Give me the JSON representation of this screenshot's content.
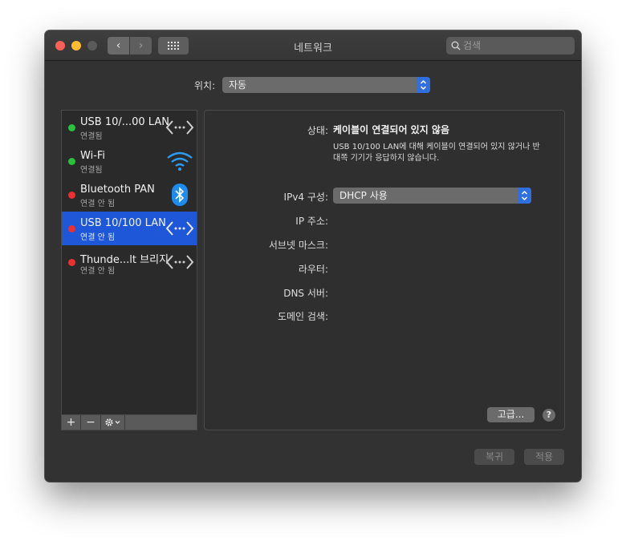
{
  "window": {
    "title": "네트워크"
  },
  "toolbar": {
    "back_icon": "chevron-left-icon",
    "forward_icon": "chevron-right-icon",
    "grid_icon": "grid-icon",
    "search_placeholder": "검색"
  },
  "location": {
    "label": "위치:",
    "value": "자동"
  },
  "services": [
    {
      "name": "USB 10/...00 LAN",
      "status": "연결됨",
      "dot_color": "#27c33c",
      "icon": "ethernet-icon",
      "selected": false
    },
    {
      "name": "Wi-Fi",
      "status": "연결됨",
      "dot_color": "#27c33c",
      "icon": "wifi-icon",
      "selected": false
    },
    {
      "name": "Bluetooth PAN",
      "status": "연결 안 됨",
      "dot_color": "#ed2f2f",
      "icon": "bluetooth-icon",
      "selected": false
    },
    {
      "name": "USB 10/100 LAN",
      "status": "연결 안 됨",
      "dot_color": "#ed2f2f",
      "icon": "ethernet-icon",
      "selected": true
    },
    {
      "name": "Thunde...lt 브리지",
      "status": "연결 안 됨",
      "dot_color": "#ed2f2f",
      "icon": "ethernet-icon",
      "selected": false
    }
  ],
  "sidebar_toolbar": {
    "add": "+",
    "remove": "−",
    "gear_icon": "gear-icon"
  },
  "detail": {
    "status_label": "상태:",
    "status_value": "케이블이 연결되어 있지 않음",
    "status_description": "USB 10/100 LAN에 대해 케이블이 연결되어 있지 않거나 반대쪽 기기가 응답하지 않습니다.",
    "ipv4_label": "IPv4 구성:",
    "ipv4_value": "DHCP 사용",
    "ip_label": "IP 주소:",
    "subnet_label": "서브넷 마스크:",
    "router_label": "라우터:",
    "dns_label": "DNS 서버:",
    "search_domain_label": "도메인 검색:",
    "advanced_button": "고급...",
    "help_button": "?"
  },
  "footer": {
    "revert": "복귀",
    "apply": "적용"
  },
  "colors": {
    "accent": "#1f57d9",
    "connected": "#27c33c",
    "disconnected": "#ed2f2f"
  }
}
